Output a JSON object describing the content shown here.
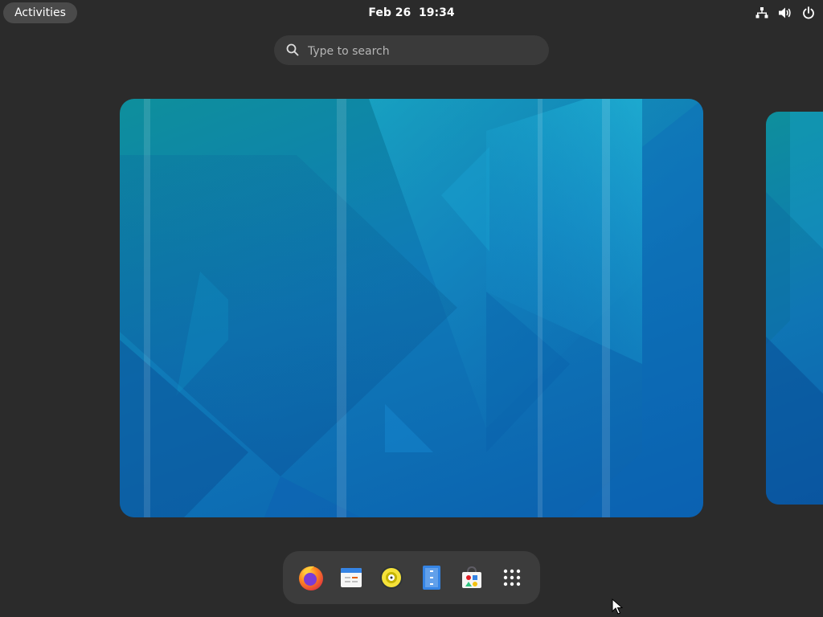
{
  "topbar": {
    "activities_label": "Activities",
    "clock": "Feb 26  19:34",
    "status_icons": [
      "network-wired-icon",
      "volume-icon",
      "power-icon"
    ]
  },
  "search": {
    "placeholder": "Type to search",
    "value": ""
  },
  "workspaces": [
    {
      "name": "workspace-1",
      "state": "current"
    },
    {
      "name": "workspace-2",
      "state": "adjacent"
    }
  ],
  "dash": {
    "apps": [
      "firefox-icon",
      "calendar-icon",
      "rhythmbox-icon",
      "files-icon",
      "software-icon"
    ],
    "show_apps": "show-apps-grid-icon"
  },
  "colors": {
    "panel_bg": "#2b2b2b",
    "activities_bg": "#4a4a4a",
    "search_bg": "#3a3a3a",
    "dash_bg": "#3c3c3c",
    "wallpaper_teal": "#0e8f9c",
    "wallpaper_blue": "#0b5fae"
  }
}
